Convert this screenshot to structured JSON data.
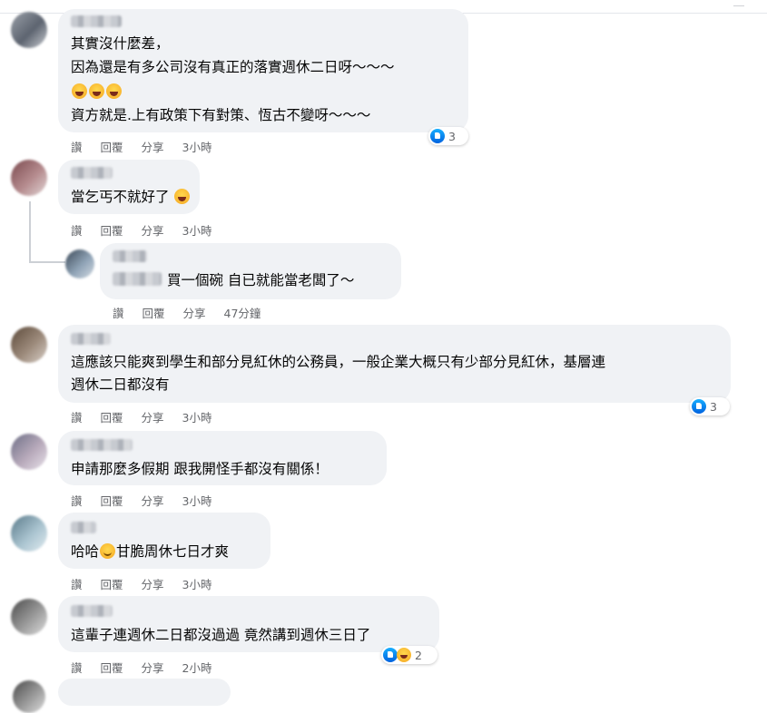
{
  "comments": [
    {
      "lines": [
        "其實沒什麼差，",
        "因為還是有多公司沒有真正的落實週休二日呀～～～",
        "",
        "資方就是.上有政策下有對策、恆古不變呀～～～"
      ],
      "actions": {
        "like": "讚",
        "reply": "回覆",
        "share": "分享",
        "time": "3小時"
      },
      "reactions": {
        "count": "3"
      }
    },
    {
      "lines": [
        "當乞丐不就好了"
      ],
      "actions": {
        "like": "讚",
        "reply": "回覆",
        "share": "分享",
        "time": "3小時"
      }
    },
    {
      "lines": [
        "買一個碗 自已就能當老闆了～"
      ],
      "actions": {
        "like": "讚",
        "reply": "回覆",
        "share": "分享",
        "time": "47分鐘"
      }
    },
    {
      "lines": [
        "這應該只能爽到學生和部分見紅休的公務員，一般企業大概只有少部分見紅休，基層連",
        "週休二日都沒有"
      ],
      "actions": {
        "like": "讚",
        "reply": "回覆",
        "share": "分享",
        "time": "3小時"
      },
      "reactions": {
        "count": "3"
      }
    },
    {
      "lines": [
        "申請那麼多假期 跟我開怪手都沒有關係！"
      ],
      "actions": {
        "like": "讚",
        "reply": "回覆",
        "share": "分享",
        "time": "3小時"
      }
    },
    {
      "lines": [
        "哈哈",
        "甘脆周休七日才爽"
      ],
      "actions": {
        "like": "讚",
        "reply": "回覆",
        "share": "分享",
        "time": "3小時"
      }
    },
    {
      "lines": [
        "這輩子連週休二日都沒過過 竟然講到週休三日了"
      ],
      "actions": {
        "like": "讚",
        "reply": "回覆",
        "share": "分享",
        "time": "2小時"
      },
      "reactions": {
        "count": "2"
      }
    }
  ],
  "icons": {
    "like": "like-reaction-icon",
    "haha": "haha-reaction-icon",
    "emoji_laugh": "rolling-laugh-emoji",
    "emoji_smile": "smile-emoji"
  },
  "colors": {
    "bubble": "#f0f2f5",
    "meta": "#65676b",
    "like_blue": "#1877f2"
  }
}
